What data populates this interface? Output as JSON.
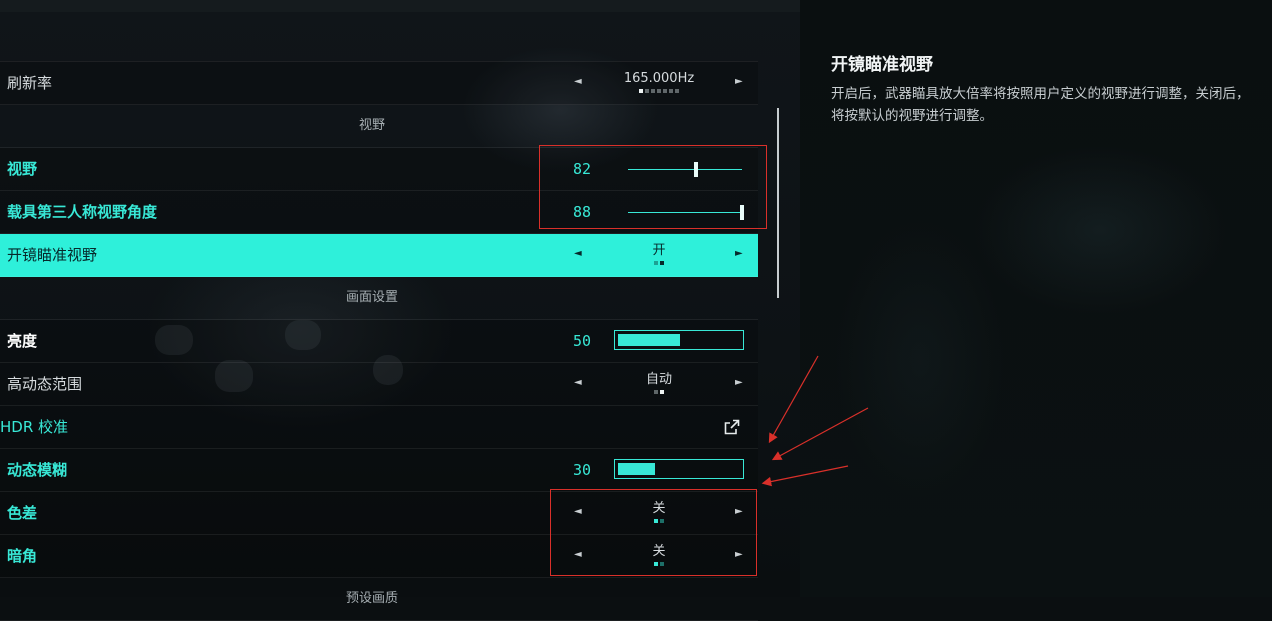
{
  "settings": {
    "refresh_rate": {
      "label": "刷新率",
      "value": "165.000Hz",
      "option_count": 7,
      "option_index": 0
    },
    "section_view": "视野",
    "fov": {
      "label": "视野",
      "value": "82",
      "level_pct": 60
    },
    "vehicle_fov": {
      "label": "载具第三人称视野角度",
      "value": "88",
      "level_pct": 100
    },
    "ads_fov": {
      "label": "开镜瞄准视野",
      "value": "开",
      "option_count": 2,
      "option_index": 1
    },
    "section_display": "画面设置",
    "brightness": {
      "label": "亮度",
      "value": "50",
      "level_pct": 52
    },
    "hdr": {
      "label": "高动态范围",
      "value": "自动",
      "option_count": 2,
      "option_index": 1
    },
    "hdr_calibration": {
      "label": "HDR 校准",
      "icon": "external-link-icon"
    },
    "motion_blur": {
      "label": "动态模糊",
      "value": "30",
      "level_pct": 31
    },
    "chromatic_aberration": {
      "label": "色差",
      "value": "关",
      "option_count": 2,
      "option_index": 0
    },
    "vignette": {
      "label": "暗角",
      "value": "关",
      "option_count": 2,
      "option_index": 0
    },
    "section_preset": "预设画质"
  },
  "description": {
    "title": "开镜瞄准视野",
    "body": "开启后，武器瞄具放大倍率将按照用户定义的视野进行调整，关闭后，将按默认的视野进行调整。"
  },
  "colors": {
    "accent": "#38e8d6",
    "highlight": "#2ef0da",
    "annotation": "#d9302a"
  },
  "icons": {
    "left_arrow": "◄",
    "right_arrow": "►"
  }
}
